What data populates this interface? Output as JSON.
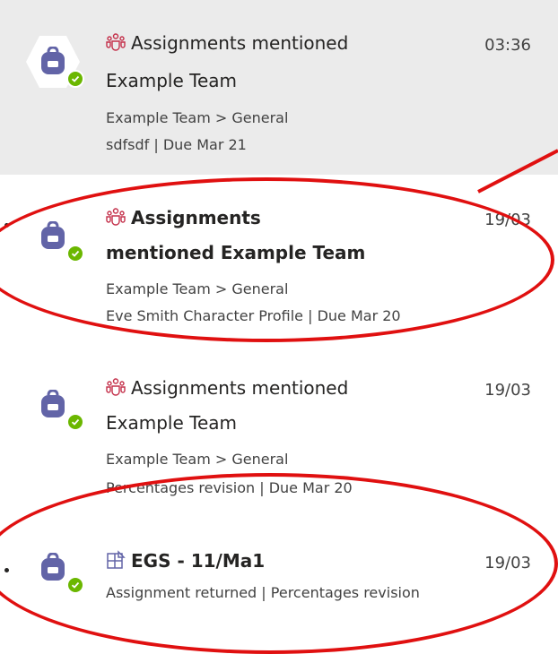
{
  "colors": {
    "accent": "#6264a7",
    "status": "#6bb700",
    "annotation": "#e01010",
    "mentions": "#c4314b"
  },
  "activities": [
    {
      "type_icon": "team-icon",
      "title": "Assignments mentioned",
      "title2": "Example Team",
      "time": "03:36",
      "path": "Example Team > General",
      "detail": "sdfsdf | Due Mar 21"
    },
    {
      "type_icon": "team-icon",
      "title": "Assignments",
      "title2": "mentioned Example Team",
      "time": "19/03",
      "path": "Example Team > General",
      "detail": "Eve Smith Character Profile | Due Mar 20"
    },
    {
      "type_icon": "team-icon",
      "title": "Assignments mentioned",
      "title2": "Example Team",
      "time": "19/03",
      "path": "Example Team > General",
      "detail": "Percentages revision | Due Mar 20"
    },
    {
      "type_icon": "class-icon",
      "title": "EGS - 11/Ma1",
      "time": "19/03",
      "detail": "Assignment returned | Percentages revision"
    }
  ]
}
